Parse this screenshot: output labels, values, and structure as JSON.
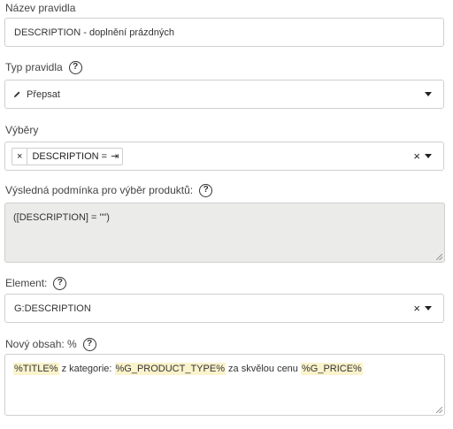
{
  "rule_name": {
    "label": "Název pravidla",
    "value": "DESCRIPTION - doplnění prázdných"
  },
  "rule_type": {
    "label": "Typ pravidla",
    "help": "?",
    "value": "Přepsat",
    "icon": "pencil-icon"
  },
  "selections": {
    "label": "Výběry",
    "chip_remove": "×",
    "chip_label": "DESCRIPTION =",
    "chip_icon": "⇥",
    "clear": "×"
  },
  "condition": {
    "label": "Výsledná podmínka pro výběr produktů:",
    "help": "?",
    "value": "([DESCRIPTION] = \"\")"
  },
  "element": {
    "label": "Element:",
    "help": "?",
    "value": "G:DESCRIPTION",
    "clear": "×"
  },
  "new_content": {
    "label": "Nový obsah: %",
    "help": "?",
    "parts": [
      "%TITLE%",
      " z kategorie: ",
      "%G_PRODUCT_TYPE%",
      " za skvělou cenu ",
      "%G_PRICE%"
    ]
  }
}
